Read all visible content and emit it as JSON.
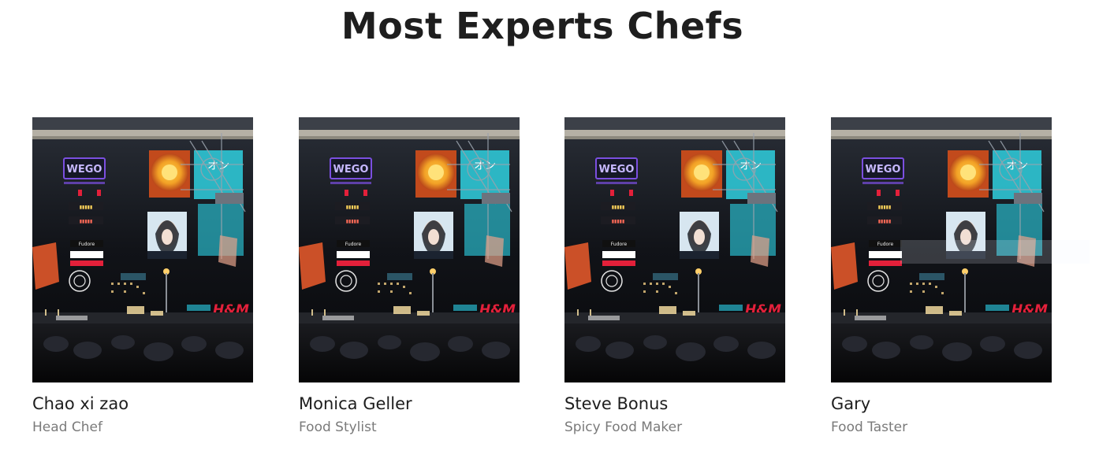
{
  "section": {
    "title": "Most Experts Chefs"
  },
  "chefs": [
    {
      "name": "Chao xi zao",
      "role": "Head Chef"
    },
    {
      "name": "Monica Geller",
      "role": "Food Stylist"
    },
    {
      "name": "Steve Bonus",
      "role": "Spicy Food Maker"
    },
    {
      "name": "Gary",
      "role": "Food Taster"
    }
  ],
  "photo": {
    "signs": [
      "WEGO",
      "H&M",
      "Fudore",
      "オン"
    ]
  },
  "colors": {
    "title": "#1e1e1e",
    "role_text": "#7a7a7a",
    "photo_bg": "#0c0d10",
    "neon_red": "#e3203a",
    "neon_cyan": "#2fd0df",
    "neon_orange": "#f2a126",
    "neon_purple": "#7b4fe0"
  }
}
